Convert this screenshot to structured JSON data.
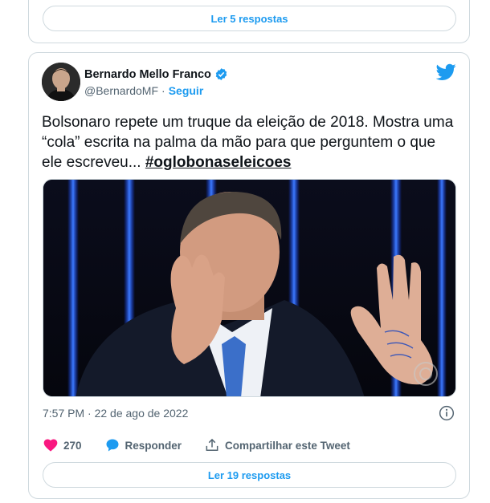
{
  "top_card": {
    "button_label": "Ler 5 respostas"
  },
  "tweet": {
    "author_name": "Bernardo Mello Franco",
    "handle": "@BernardoMF",
    "separator": "·",
    "follow_label": "Seguir",
    "text_before_hashtag": "Bolsonaro repete um truque da eleição de 2018. Mostra uma “cola” escrita na palma da mão para que perguntem o que ele escreveu... ",
    "hashtag": "#oglobonaseleicoes",
    "timestamp": "7:57 PM · 22 de ago de 2022",
    "like_count": "270",
    "reply_label": "Responder",
    "share_label": "Compartilhar este Tweet",
    "read_replies_label": "Ler 19 respostas"
  },
  "icons": [
    "verified-badge-icon",
    "twitter-bird-icon",
    "info-icon",
    "heart-icon",
    "reply-bubble-icon",
    "share-icon"
  ],
  "colors": {
    "accent": "#1d9bf0",
    "like": "#f91880",
    "text": "#0f1419",
    "muted": "#536471",
    "border": "#cfd9de"
  }
}
